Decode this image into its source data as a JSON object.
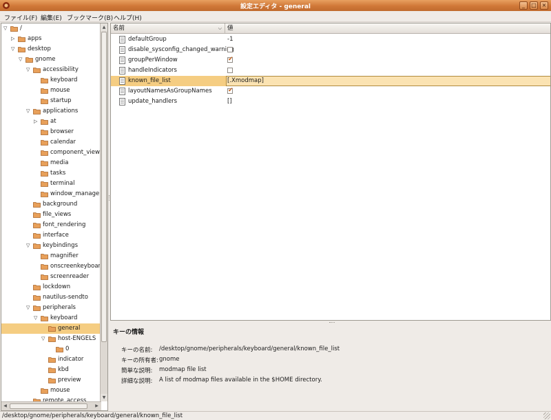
{
  "window": {
    "title": "設定エディタ - general"
  },
  "menubar": {
    "items": [
      "ファイル(F)",
      "編集(E)",
      "ブックマーク(B)",
      "ヘルプ(H)"
    ]
  },
  "tree": {
    "rows": [
      {
        "label": "/",
        "depth": 0,
        "expander": "open"
      },
      {
        "label": "apps",
        "depth": 1,
        "expander": "closed"
      },
      {
        "label": "desktop",
        "depth": 1,
        "expander": "open"
      },
      {
        "label": "gnome",
        "depth": 2,
        "expander": "open"
      },
      {
        "label": "accessibility",
        "depth": 3,
        "expander": "open"
      },
      {
        "label": "keyboard",
        "depth": 4,
        "expander": "none"
      },
      {
        "label": "mouse",
        "depth": 4,
        "expander": "none"
      },
      {
        "label": "startup",
        "depth": 4,
        "expander": "none"
      },
      {
        "label": "applications",
        "depth": 3,
        "expander": "open"
      },
      {
        "label": "at",
        "depth": 4,
        "expander": "closed"
      },
      {
        "label": "browser",
        "depth": 4,
        "expander": "none"
      },
      {
        "label": "calendar",
        "depth": 4,
        "expander": "none"
      },
      {
        "label": "component_viewer",
        "depth": 4,
        "expander": "none"
      },
      {
        "label": "media",
        "depth": 4,
        "expander": "none"
      },
      {
        "label": "tasks",
        "depth": 4,
        "expander": "none"
      },
      {
        "label": "terminal",
        "depth": 4,
        "expander": "none"
      },
      {
        "label": "window_manager",
        "depth": 4,
        "expander": "none"
      },
      {
        "label": "background",
        "depth": 3,
        "expander": "none"
      },
      {
        "label": "file_views",
        "depth": 3,
        "expander": "none"
      },
      {
        "label": "font_rendering",
        "depth": 3,
        "expander": "none"
      },
      {
        "label": "interface",
        "depth": 3,
        "expander": "none"
      },
      {
        "label": "keybindings",
        "depth": 3,
        "expander": "open"
      },
      {
        "label": "magnifier",
        "depth": 4,
        "expander": "none"
      },
      {
        "label": "onscreenkeyboard",
        "depth": 4,
        "expander": "none"
      },
      {
        "label": "screenreader",
        "depth": 4,
        "expander": "none"
      },
      {
        "label": "lockdown",
        "depth": 3,
        "expander": "none"
      },
      {
        "label": "nautilus-sendto",
        "depth": 3,
        "expander": "none"
      },
      {
        "label": "peripherals",
        "depth": 3,
        "expander": "open"
      },
      {
        "label": "keyboard",
        "depth": 4,
        "expander": "open"
      },
      {
        "label": "general",
        "depth": 5,
        "expander": "none",
        "selected": true
      },
      {
        "label": "host-ENGELS",
        "depth": 5,
        "expander": "open"
      },
      {
        "label": "0",
        "depth": 6,
        "expander": "none"
      },
      {
        "label": "indicator",
        "depth": 5,
        "expander": "none"
      },
      {
        "label": "kbd",
        "depth": 5,
        "expander": "none"
      },
      {
        "label": "preview",
        "depth": 5,
        "expander": "none"
      },
      {
        "label": "mouse",
        "depth": 4,
        "expander": "none"
      },
      {
        "label": "remote_access",
        "depth": 3,
        "expander": "none"
      }
    ]
  },
  "keylist": {
    "columns": {
      "name": "名前",
      "value": "値"
    },
    "rows": [
      {
        "name": "defaultGroup",
        "type": "int",
        "value": "-1"
      },
      {
        "name": "disable_sysconfig_changed_warning",
        "type": "bool",
        "checked": false
      },
      {
        "name": "groupPerWindow",
        "type": "bool",
        "checked": true
      },
      {
        "name": "handleIndicators",
        "type": "bool",
        "checked": false
      },
      {
        "name": "known_file_list",
        "type": "list",
        "value": "[.Xmodmap]",
        "selected": true
      },
      {
        "name": "layoutNamesAsGroupNames",
        "type": "bool",
        "checked": true
      },
      {
        "name": "update_handlers",
        "type": "list",
        "value": "[]"
      }
    ]
  },
  "info": {
    "title": "キーの情報",
    "rows": [
      {
        "label": "キーの名前:",
        "value": "/desktop/gnome/peripherals/keyboard/general/known_file_list"
      },
      {
        "label": "キーの所有者:",
        "value": "gnome"
      },
      {
        "label": "簡単な説明:",
        "value": "modmap file list"
      },
      {
        "label": "詳細な説明:",
        "value": "A list of modmap files available in the $HOME directory."
      }
    ]
  },
  "statusbar": {
    "text": "/desktop/gnome/peripherals/keyboard/general/known_file_list"
  },
  "colors": {
    "titlebar": "#d07838",
    "selection": "#f5cd82",
    "folder": "#e8a05a",
    "check": "#c8641e"
  }
}
